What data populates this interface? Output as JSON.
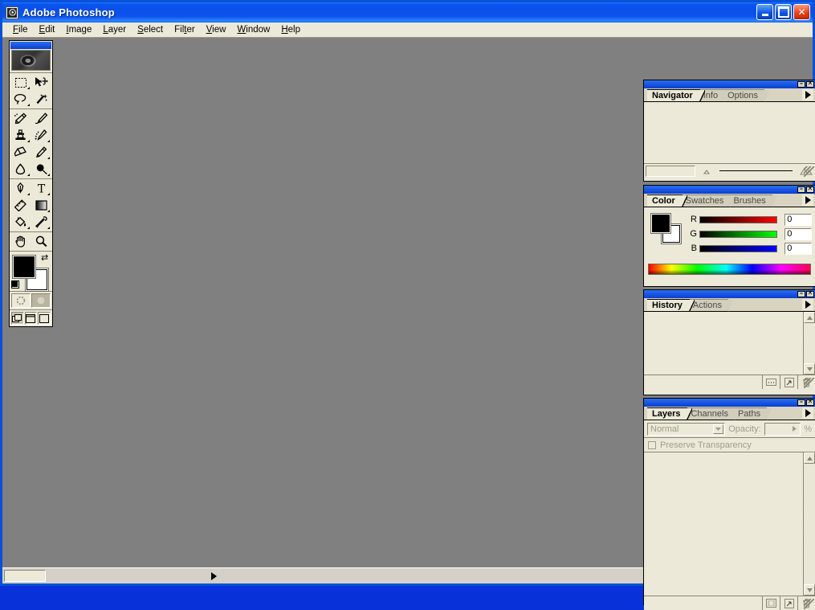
{
  "window": {
    "title": "Adobe Photoshop",
    "app_icon": "photoshop-eye-icon",
    "minimize_label": "–",
    "maximize_label": "□",
    "close_label": "✕"
  },
  "menubar": {
    "items": [
      {
        "label": "File",
        "accel": "F"
      },
      {
        "label": "Edit",
        "accel": "E"
      },
      {
        "label": "Image",
        "accel": "I"
      },
      {
        "label": "Layer",
        "accel": "L"
      },
      {
        "label": "Select",
        "accel": "S"
      },
      {
        "label": "Filter",
        "accel": "t"
      },
      {
        "label": "View",
        "accel": "V"
      },
      {
        "label": "Window",
        "accel": "W"
      },
      {
        "label": "Help",
        "accel": "H"
      }
    ]
  },
  "toolbox": {
    "logo": "photoshop-eye-logo",
    "tools": [
      {
        "name": "marquee-tool",
        "label": "Rectangular Marquee",
        "has_flyout": true
      },
      {
        "name": "move-tool",
        "label": "Move",
        "has_flyout": false
      },
      {
        "name": "lasso-tool",
        "label": "Lasso",
        "has_flyout": true
      },
      {
        "name": "magic-wand-tool",
        "label": "Magic Wand",
        "has_flyout": false
      },
      {
        "name": "airbrush-tool",
        "label": "Airbrush",
        "has_flyout": false
      },
      {
        "name": "paintbrush-tool",
        "label": "Paintbrush",
        "has_flyout": false
      },
      {
        "name": "rubber-stamp-tool",
        "label": "Rubber Stamp",
        "has_flyout": true
      },
      {
        "name": "history-brush-tool",
        "label": "History Brush",
        "has_flyout": true
      },
      {
        "name": "eraser-tool",
        "label": "Eraser",
        "has_flyout": false
      },
      {
        "name": "pencil-tool",
        "label": "Pencil",
        "has_flyout": true
      },
      {
        "name": "blur-tool",
        "label": "Blur",
        "has_flyout": true
      },
      {
        "name": "dodge-tool",
        "label": "Dodge",
        "has_flyout": true
      },
      {
        "name": "pen-tool",
        "label": "Pen",
        "has_flyout": true
      },
      {
        "name": "type-tool",
        "label": "Type",
        "has_flyout": true
      },
      {
        "name": "measure-tool",
        "label": "Measure",
        "has_flyout": false
      },
      {
        "name": "gradient-tool",
        "label": "Gradient",
        "has_flyout": true
      },
      {
        "name": "paint-bucket-tool",
        "label": "Paint Bucket",
        "has_flyout": true
      },
      {
        "name": "eyedropper-tool",
        "label": "Eyedropper",
        "has_flyout": true
      },
      {
        "name": "hand-tool",
        "label": "Hand",
        "has_flyout": false
      },
      {
        "name": "zoom-tool",
        "label": "Zoom",
        "has_flyout": false
      }
    ],
    "colors": {
      "foreground": "#000000",
      "background": "#ffffff",
      "swap_icon": "swap-colors-icon",
      "reset_icon": "default-colors-icon"
    },
    "quickmask": [
      {
        "name": "standard-mode",
        "label": "Edit in Standard Mode",
        "selected": true
      },
      {
        "name": "quickmask-mode",
        "label": "Edit in Quick Mask Mode",
        "selected": false
      }
    ],
    "screenmodes": [
      {
        "name": "standard-screen-mode",
        "label": "Standard Screen Mode",
        "selected": true
      },
      {
        "name": "fullscreen-menubar-mode",
        "label": "Full Screen Mode With Menu Bar",
        "selected": false
      },
      {
        "name": "fullscreen-mode",
        "label": "Full Screen Mode",
        "selected": false
      }
    ]
  },
  "panels": {
    "navigator": {
      "tabs": [
        {
          "label": "Navigator",
          "active": true
        },
        {
          "label": "Info",
          "active": false
        },
        {
          "label": "Options",
          "active": false
        }
      ],
      "zoom_value": "",
      "zoom_out_icon": "zoom-out-mountain-icon",
      "zoom_in_icon": "zoom-in-mountain-icon",
      "menu_icon": "panel-menu-arrow-icon"
    },
    "color": {
      "tabs": [
        {
          "label": "Color",
          "active": true
        },
        {
          "label": "Swatches",
          "active": false
        },
        {
          "label": "Brushes",
          "active": false
        }
      ],
      "foreground": "#000000",
      "background": "#ffffff",
      "channels": [
        {
          "label": "R",
          "value": "0",
          "ramp_from": "#000000",
          "ramp_to": "#ff0000"
        },
        {
          "label": "G",
          "value": "0",
          "ramp_from": "#000000",
          "ramp_to": "#00ff00"
        },
        {
          "label": "B",
          "value": "0",
          "ramp_from": "#000000",
          "ramp_to": "#0000ff"
        }
      ],
      "spectrum": "color-spectrum-ramp",
      "menu_icon": "panel-menu-arrow-icon"
    },
    "history": {
      "tabs": [
        {
          "label": "History",
          "active": true
        },
        {
          "label": "Actions",
          "active": false
        }
      ],
      "items": [],
      "footer_buttons": [
        {
          "name": "new-snapshot-button",
          "icon": "snapshot-icon"
        },
        {
          "name": "new-document-button",
          "icon": "new-document-icon"
        },
        {
          "name": "delete-state-button",
          "icon": "trash-icon"
        }
      ],
      "menu_icon": "panel-menu-arrow-icon"
    },
    "layers": {
      "tabs": [
        {
          "label": "Layers",
          "active": true
        },
        {
          "label": "Channels",
          "active": false
        },
        {
          "label": "Paths",
          "active": false
        }
      ],
      "blend_mode": "Normal",
      "opacity_label": "Opacity:",
      "opacity_value": "",
      "percent_sign": "%",
      "preserve_transparency_label": "Preserve Transparency",
      "preserve_transparency_checked": false,
      "items": [],
      "footer_buttons": [
        {
          "name": "add-layer-mask-button",
          "icon": "layer-mask-icon"
        },
        {
          "name": "new-layer-button",
          "icon": "new-layer-icon"
        },
        {
          "name": "delete-layer-button",
          "icon": "trash-icon"
        }
      ],
      "menu_icon": "panel-menu-arrow-icon"
    }
  },
  "statusbar": {
    "zoom_value": "",
    "doc_info": "",
    "expand_icon": "status-expand-arrow-icon"
  },
  "colors": {
    "titlebar_blue": "#0a4fe8",
    "menubar": "#ece9d8",
    "workspace_gray": "#808080",
    "panel_face": "#ece9d8",
    "panel_shadow": "#8a8674"
  }
}
